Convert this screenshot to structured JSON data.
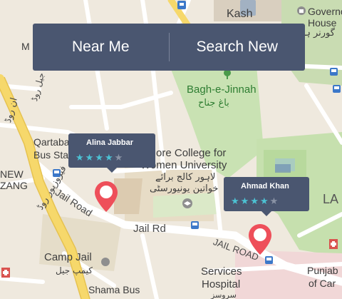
{
  "action_bar": {
    "near_me_label": "Near Me",
    "search_new_label": "Search New"
  },
  "markers": [
    {
      "name": "Alina Jabbar",
      "rating": 4,
      "max": 5
    },
    {
      "name": "Ahmad Khan",
      "rating": 4,
      "max": 5
    }
  ],
  "map_labels": {
    "kashmir": "Kash",
    "governor_house": "Governor\nHouse",
    "governor_house_urdu": "گورنر ہاؤ",
    "bagh_e_jinnah": "Bagh-e-Jinnah",
    "bagh_e_jinnah_urdu": "باغ جناح",
    "qartaba_chowk": "Qartaba Chowk",
    "bus_station": "Bus Station",
    "new_mozang": "NEW\nZANG",
    "lahore_college_1": "Lahore College for",
    "lahore_college_2": "Women University",
    "lahore_college_urdu_1": "لاہور کالج برائے",
    "lahore_college_urdu_2": "خواتین یونیورسٹی",
    "jail_road_1": "Jail Road",
    "jail_rd": "Jail Rd",
    "jail_road_2": "JAIL ROAD",
    "ferozepur_road_urdu": "فیروزپور روڈ",
    "camp_jail": "Camp Jail",
    "camp_jail_urdu": "کیمپ جیل",
    "services_hospital_1": "Services",
    "services_hospital_2": "Hospital",
    "services_urdu": "سروسز",
    "punjab_1": "Punjab",
    "punjab_2": "of Car",
    "shama_bus": "Shama Bus",
    "la": "LA",
    "ma": "M",
    "urdu_left": "ان روڈ",
    "urdu_left2": "جیل روڈ"
  },
  "colors": {
    "panel": "#4a5670",
    "star_on": "#4cc2d4",
    "star_off": "#8a93a5",
    "pin": "#ee4f5a",
    "park": "#c9e2b3",
    "road_major": "#f6d86b",
    "road": "#ffffff"
  },
  "icons": [
    "bus-stop-icon",
    "tree-icon",
    "mosque-icon",
    "museum-icon",
    "map-pin-icon",
    "star-icon"
  ]
}
